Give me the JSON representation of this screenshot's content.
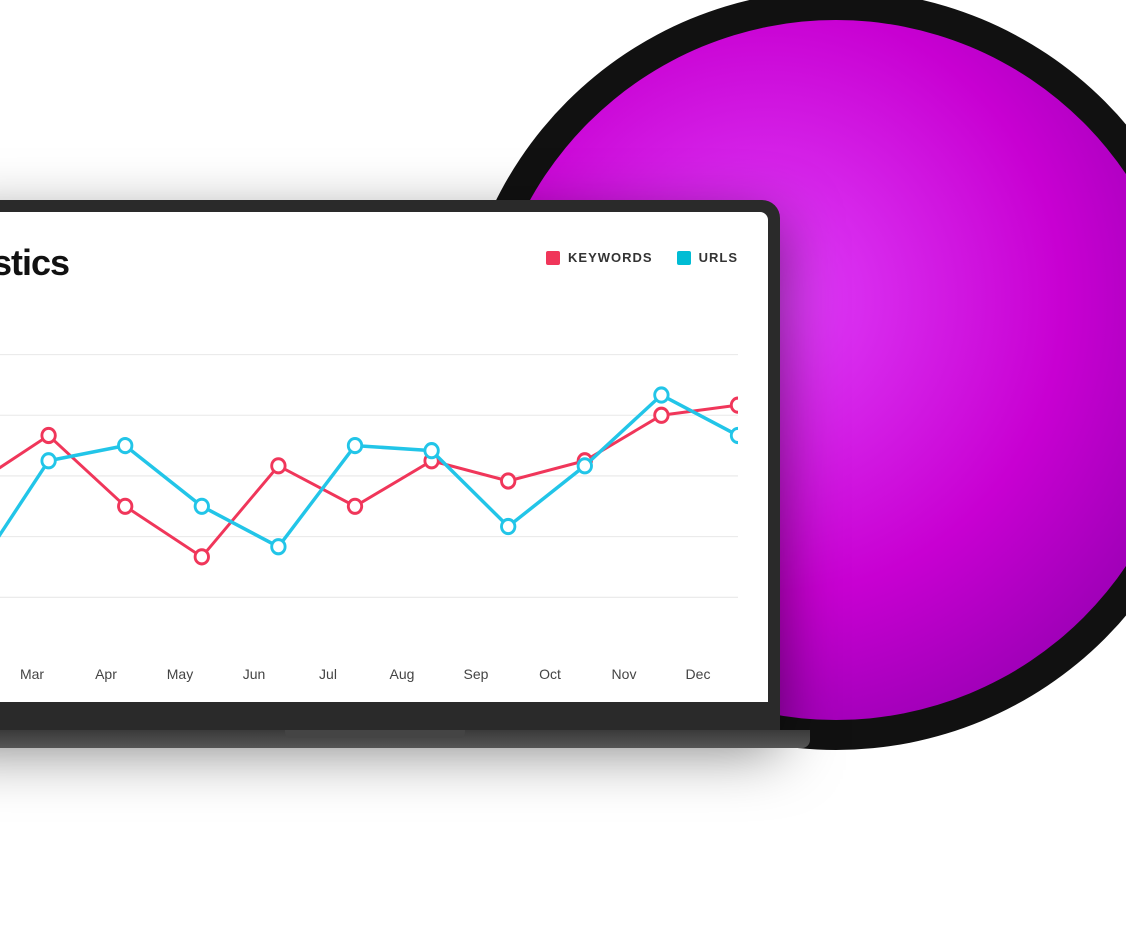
{
  "background": {
    "ring_color": "#111111",
    "circle_color": "#c800d2"
  },
  "chart": {
    "title": "tistics",
    "legend": {
      "keywords_label": "KEYWORDS",
      "urls_label": "URLS"
    },
    "x_axis": [
      "Mar",
      "Apr",
      "May",
      "Jun",
      "Jul",
      "Aug",
      "Sep",
      "Oct",
      "Nov",
      "Dec"
    ],
    "colors": {
      "pink": "#f0365a",
      "blue": "#22c5e8"
    }
  }
}
